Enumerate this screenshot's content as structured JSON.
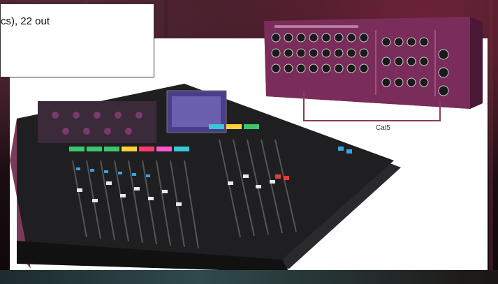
{
  "tooltip": {
    "text": "cs), 22 out"
  },
  "diagram": {
    "cable_label": "Cat5"
  },
  "colors": {
    "stagebox_body": "#7a2d5a",
    "console_body": "#1f1f22",
    "screen": "#4a3d8a",
    "cable": "#8a3b5a"
  }
}
